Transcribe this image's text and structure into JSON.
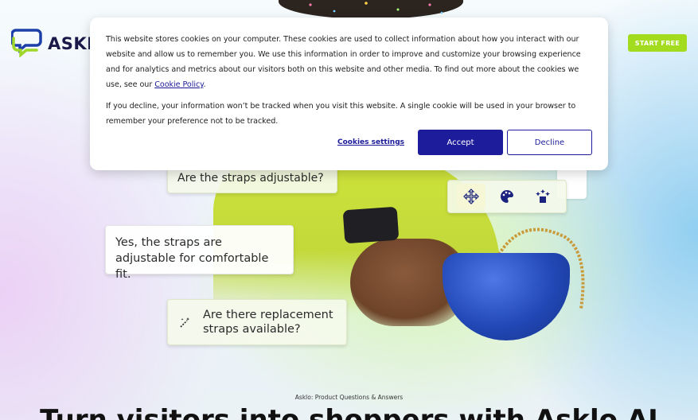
{
  "header": {
    "logo_text": "ASKLO",
    "start_button": "START FREE"
  },
  "hero": {
    "bubble_question_1": "Are the straps adjustable?",
    "bubble_answer_line1": "Yes, the straps are",
    "bubble_answer_line2": "adjustable for comfortable fit.",
    "bubble_question_2_line1": "Are there replacement",
    "bubble_question_2_line2": "straps available?",
    "tools": [
      "move-icon",
      "palette-icon",
      "stars-icon"
    ]
  },
  "footer": {
    "subtitle": "Asklo: Product Questions & Answers",
    "headline": "Turn visitors into shoppers with Asklo AI"
  },
  "cookie": {
    "text1_before_link": "This website stores cookies on your computer. These cookies are used to collect information about how you interact with our website and allow us to remember you. We use this information in order to improve and customize your browsing experience and for analytics and metrics about our visitors both on this website and other media. To find out more about the cookies we use, see our ",
    "policy_link": "Cookie Policy",
    "text1_after_link": ".",
    "text2": "If you decline, your information won’t be tracked when you visit this website. A single cookie will be used in your browser to remember your preference not to be tracked.",
    "settings_label": "Cookies settings",
    "accept_label": "Accept",
    "decline_label": "Decline"
  },
  "colors": {
    "accent_green": "#a3dc1f",
    "primary_navy": "#1d1d9c"
  }
}
